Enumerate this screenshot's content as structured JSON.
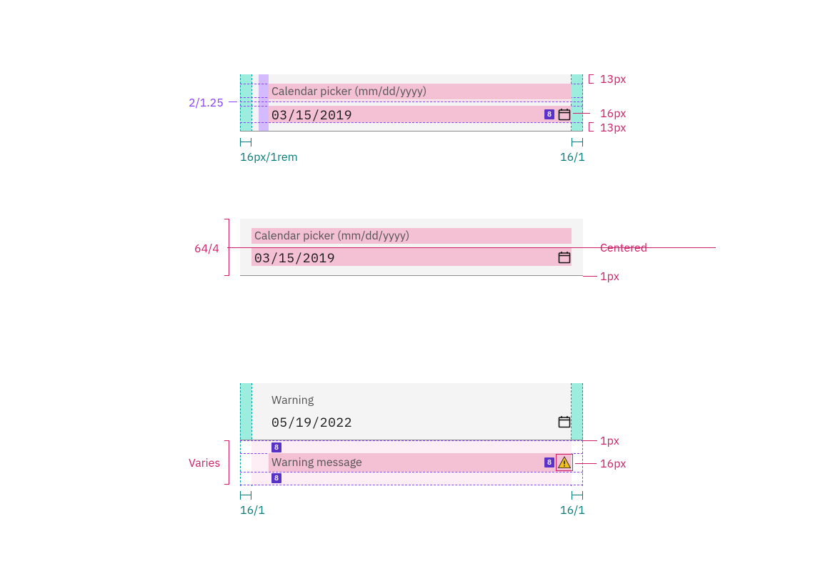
{
  "spec1": {
    "label": "Calendar picker (mm/dd/yyyy)",
    "value": "03/15/2019",
    "icon": "calendar",
    "annotations": {
      "top_padding": "13px",
      "icon_size": "16px",
      "bottom_padding": "13px",
      "left_padding": "16px/1rem",
      "right_padding": "16/1",
      "baseline_gap": "2/1.25"
    },
    "badge": "8"
  },
  "spec2": {
    "label": "Calendar picker (mm/dd/yyyy)",
    "value": "03/15/2019",
    "icon": "calendar",
    "annotations": {
      "height": "64/4",
      "vertical_alignment": "Centered",
      "border_bottom": "1px"
    }
  },
  "spec3": {
    "label": "Warning",
    "value": "05/19/2022",
    "message": "Warning message",
    "icon": "calendar",
    "message_icon": "warning-alt",
    "annotations": {
      "border_bottom": "1px",
      "message_icon_size": "16px",
      "message_row_height": "Varies",
      "padding_left": "16/1",
      "padding_right": "16/1"
    },
    "badge": "8"
  },
  "colors": {
    "field_bg": "#f4f4f4",
    "teal_fill": "#9deddf",
    "teal_stroke": "#009d9a",
    "teal_text": "#007d79",
    "purple_fill": "#d4bbff",
    "purple_stroke": "#8a3ffc",
    "pink_fill": "#f4c0d3",
    "magenta": "#cf1d67",
    "badge_bg": "#5a32c7",
    "text_secondary": "#525252",
    "text_primary": "#161616",
    "border_bottom": "#8d8d8d",
    "warning_fill": "#f1c21b"
  }
}
